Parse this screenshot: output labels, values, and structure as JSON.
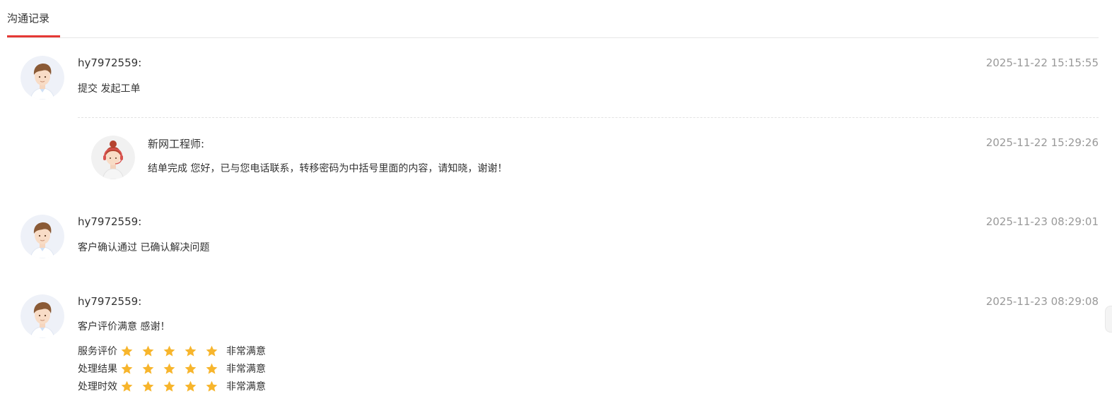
{
  "tabs": [
    {
      "label": "沟通记录"
    }
  ],
  "records": [
    {
      "name": "hy7972559:",
      "time": "2025-11-22 15:15:55",
      "message": "提交 发起工单"
    },
    {
      "name": "新网工程师:",
      "time": "2025-11-22 15:29:26",
      "message": "结单完成 您好，已与您电话联系，转移密码为中括号里面的内容，请知晓，谢谢！"
    },
    {
      "name": "hy7972559:",
      "time": "2025-11-23 08:29:01",
      "message": "客户确认通过 已确认解决问题"
    },
    {
      "name": "hy7972559:",
      "time": "2025-11-23 08:29:08",
      "message": "客户评价满意 感谢！"
    }
  ],
  "ratings": [
    {
      "label": "服务评价",
      "stars": 5,
      "max": 5,
      "verdict": "非常满意"
    },
    {
      "label": "处理结果",
      "stars": 5,
      "max": 5,
      "verdict": "非常满意"
    },
    {
      "label": "处理时效",
      "stars": 5,
      "max": 5,
      "verdict": "非常满意"
    }
  ],
  "icons": {
    "user_avatar": "user-avatar-icon",
    "engineer_avatar": "engineer-avatar-icon",
    "star": "star-icon"
  },
  "colors": {
    "accent": "#e53935",
    "star": "#f7b52c",
    "muted_text": "#999999"
  }
}
